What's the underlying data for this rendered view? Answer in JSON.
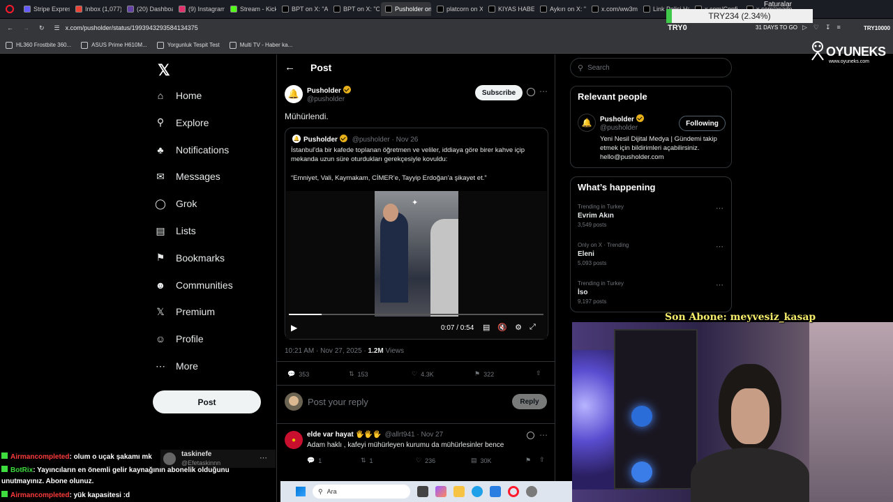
{
  "browser": {
    "tabs": [
      {
        "label": "Stripe Express",
        "color": "#635bff"
      },
      {
        "label": "Inbox (1,077)",
        "color": "#ea4335"
      },
      {
        "label": "(20) Dashboard",
        "color": "#6441a5"
      },
      {
        "label": "(9) Instagram",
        "color": "#e1306c"
      },
      {
        "label": "Stream - Kick",
        "color": "#53fc18"
      },
      {
        "label": "BPT on X: \"A",
        "color": "#000000"
      },
      {
        "label": "BPT on X: \"O",
        "color": "#000000"
      },
      {
        "label": "Pusholder on X: \"Mühü",
        "color": "#000000"
      },
      {
        "label": "platcorn on X",
        "color": "#000000"
      },
      {
        "label": "KIYAS HABER",
        "color": "#000000"
      },
      {
        "label": "Aykırı on X: \"",
        "color": "#000000"
      },
      {
        "label": "x.com/ww3m",
        "color": "#000000"
      },
      {
        "label": "Link Polisi Ha",
        "color": "#000000"
      },
      {
        "label": "x.com/Confi",
        "color": "#000000"
      },
      {
        "label": "x.com/anado",
        "color": "#000000"
      }
    ],
    "active_tab_index": 7,
    "url": "x.com/pusholder/status/1993943293584134375",
    "bookmarks": [
      {
        "label": "HL360 Frostbite 360...",
        "icon": "link-icon"
      },
      {
        "label": "ASUS Prime H610M...",
        "icon": "asus-icon"
      },
      {
        "label": "Yorgunluk Tespit Test",
        "icon": "folder-icon"
      },
      {
        "label": "Multi TV - Haber ka...",
        "icon": "doc-icon"
      }
    ]
  },
  "overlay": {
    "stock_label": "TRY234 (2.34%)",
    "stock_progress_percent": 2.34,
    "faturalar": "Faturalar",
    "tryo": "TRY0",
    "days_to_go": "31 DAYS TO GO",
    "tryo_right": "TRY10000",
    "oyuneks": "OYUNEKS",
    "oyuneks_site": "www.oyuneks.com",
    "son_abone": "Son Abone: meyvesiz_kasap"
  },
  "nav": {
    "items": [
      {
        "label": "Home",
        "icon": "home-icon"
      },
      {
        "label": "Explore",
        "icon": "search-icon"
      },
      {
        "label": "Notifications",
        "icon": "bell-icon"
      },
      {
        "label": "Messages",
        "icon": "mail-icon"
      },
      {
        "label": "Grok",
        "icon": "grok-icon"
      },
      {
        "label": "Lists",
        "icon": "list-icon"
      },
      {
        "label": "Bookmarks",
        "icon": "bookmark-icon"
      },
      {
        "label": "Communities",
        "icon": "communities-icon"
      },
      {
        "label": "Premium",
        "icon": "x-icon"
      },
      {
        "label": "Profile",
        "icon": "profile-icon"
      },
      {
        "label": "More",
        "icon": "more-icon"
      }
    ],
    "post_button": "Post"
  },
  "post": {
    "header": "Post",
    "author_name": "Pusholder",
    "author_handle": "@pusholder",
    "subscribe": "Subscribe",
    "text": "Mühürlendi.",
    "quote": {
      "author_name": "Pusholder",
      "author_handle": "@pusholder",
      "date": "Nov 26",
      "text1": "İstanbul'da bir kafede toplanan öğretmen ve veliler, iddiaya göre birer kahve içip mekanda uzun süre oturdukları gerekçesiyle kovuldu:",
      "text2": "“Emniyet, Vali, Kaymakam, CİMER’e, Tayyip Erdoğan’a şikayet et.”",
      "video_time": "0:07 / 0:54",
      "video_progress_percent": 13
    },
    "timestamp": "10:21 AM · Nov 27, 2025 · ",
    "views_count": "1.2M",
    "views_label": " Views",
    "stats": {
      "replies": "353",
      "reposts": "153",
      "likes": "4.3K",
      "bookmarks": "322"
    },
    "reply_placeholder": "Post your reply",
    "reply_button": "Reply"
  },
  "reply": {
    "author_name": "elde var hayat 🖐🖐🖐",
    "author_handle": "@allrt941",
    "date": "Nov 27",
    "text": "Adam haklı , kafeyi mühürleyen kurumu da mühürlesinler bence",
    "stats": {
      "replies": "1",
      "reposts": "1",
      "likes": "236",
      "views": "30K"
    }
  },
  "sidebar": {
    "search_placeholder": "Search",
    "relevant_title": "Relevant people",
    "person_name": "Pusholder",
    "person_handle": "@pusholder",
    "person_bio": "Yeni Nesil Dijital Medya | Gündemi takip etmek için bildirimleri açabilirsiniz. hello@pusholder.com",
    "following_button": "Following",
    "happening_title": "What’s happening",
    "trends": [
      {
        "meta": "Trending in Turkey",
        "name": "Evrim Akın",
        "count": "3,549 posts"
      },
      {
        "meta": "Only on X · Trending",
        "name": "Eleni",
        "count": "5,093 posts"
      },
      {
        "meta": "Trending in Turkey",
        "name": "İso",
        "count": "9,197 posts"
      }
    ]
  },
  "chat": {
    "messages": [
      {
        "user": "Airmancompleted",
        "text": ": olum o uçak şakamı mk",
        "color": "#ff3b3b"
      },
      {
        "user": "BotRix",
        "text": ": Yayıncıların en önemli gelir kaynağının abonelik olduğunu unutmayınız. Abone olunuz.",
        "color": "#3fdc3f"
      },
      {
        "user": "Airmancompleted",
        "text": ": yük kapasitesi :d",
        "color": "#ff3b3b"
      }
    ],
    "overlay_user": "taskinefe",
    "overlay_handle": "@Efetaskinnn"
  },
  "taskbar": {
    "search_label": "Ara"
  }
}
